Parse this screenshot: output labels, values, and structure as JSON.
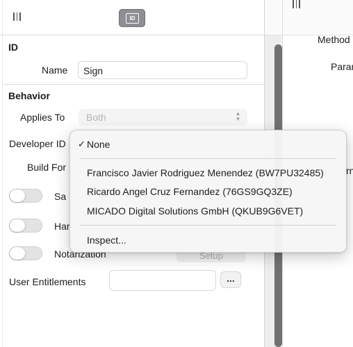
{
  "inspector": {
    "id_tab_label": "ID",
    "id_section": {
      "title": "ID",
      "name_label": "Name",
      "name_value": "Sign"
    },
    "behavior_section": {
      "title": "Behavior",
      "applies_to_label": "Applies To",
      "applies_to_value": "Both",
      "developer_id_label": "Developer ID",
      "build_for_label": "Build For",
      "sandbox_label": "Sa",
      "hardened_label": "Har",
      "notarization_label": "Notarization",
      "setup_button": "Setup",
      "user_entitlements_label": "User Entitlements",
      "user_entitlements_value": "",
      "more_button": "..."
    }
  },
  "right_panel": {
    "method_label": "Method",
    "params_label": "Param",
    "cut_label": "rn"
  },
  "developer_id_menu": {
    "selected": "None",
    "items": [
      {
        "label": "None",
        "checked": true
      },
      {
        "label": "Francisco Javier Rodriguez Menendez (BW7PU32485)",
        "checked": false
      },
      {
        "label": "Ricardo Angel Cruz Fernandez (76GS9GQ3ZE)",
        "checked": false
      },
      {
        "label": "MICADO Digital Solutions GmbH (QKUB9G6VET)",
        "checked": false
      },
      {
        "label": "Inspect...",
        "checked": false
      }
    ],
    "checkmark": "✓"
  },
  "colors": {
    "selected_tab": "#8e8e93",
    "scroll_thumb": "#717171"
  }
}
